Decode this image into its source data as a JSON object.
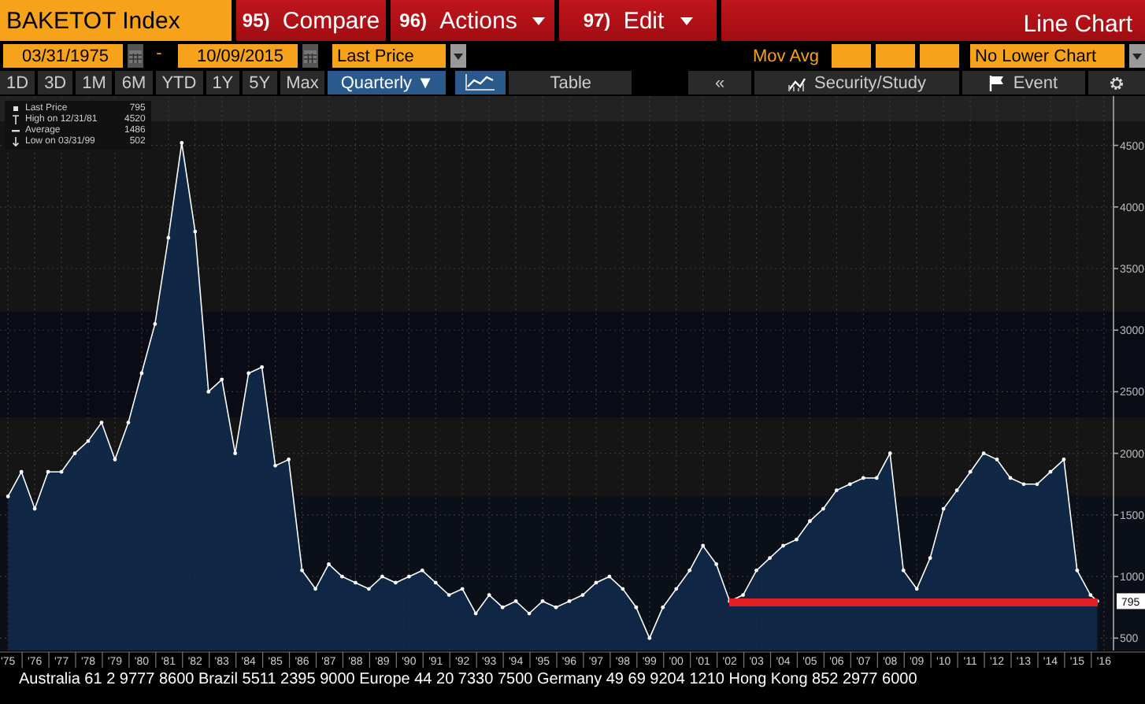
{
  "header": {
    "security": "BAKETOT Index",
    "buttons": [
      {
        "number": "95)",
        "label": "Compare",
        "dropdown": false
      },
      {
        "number": "96)",
        "label": "Actions",
        "dropdown": true
      },
      {
        "number": "97)",
        "label": "Edit",
        "dropdown": true
      }
    ],
    "chart_type": "Line Chart"
  },
  "range": {
    "start_date": "03/31/1975",
    "separator": "-",
    "end_date": "10/09/2015",
    "price_field": "Last Price",
    "mov_avg_label": "Mov Avg",
    "lower_chart": "No Lower Chart"
  },
  "toolbar": {
    "periods": [
      {
        "label": "1D",
        "selected": false
      },
      {
        "label": "3D",
        "selected": false
      },
      {
        "label": "1M",
        "selected": false
      },
      {
        "label": "6M",
        "selected": false
      },
      {
        "label": "YTD",
        "selected": false
      },
      {
        "label": "1Y",
        "selected": false
      },
      {
        "label": "5Y",
        "selected": false
      },
      {
        "label": "Max",
        "selected": false
      }
    ],
    "frequency": "Quarterly ▼",
    "views": [
      {
        "kind": "icon",
        "selected": true
      },
      {
        "kind": "text",
        "label": "Table",
        "selected": false
      }
    ],
    "back": "«",
    "security_study": "Security/Study",
    "event": "Event"
  },
  "chart": {
    "legend": [
      {
        "kind": "last",
        "value": "795"
      },
      {
        "kind": "high",
        "label": "High on 12/31/81",
        "value": "4520"
      },
      {
        "kind": "average",
        "label": "Average",
        "value": "1486"
      },
      {
        "kind": "low",
        "label": "Low on 03/31/99",
        "value": "502"
      }
    ],
    "last_tag": "795",
    "chart_data": {
      "type": "area",
      "xlim": [
        1974.7,
        2016.3
      ],
      "ylim": [
        400,
        4900
      ],
      "x": [
        1975,
        1975.5,
        1976,
        1976.5,
        1977,
        1977.5,
        1978,
        1978.5,
        1979,
        1979.5,
        1980,
        1980.5,
        1981,
        1981.5,
        1982,
        1982.5,
        1983,
        1983.5,
        1984,
        1984.5,
        1985,
        1985.5,
        1986,
        1986.5,
        1987,
        1987.5,
        1988,
        1988.5,
        1989,
        1989.5,
        1990,
        1990.5,
        1991,
        1991.5,
        1992,
        1992.5,
        1993,
        1993.5,
        1994,
        1994.5,
        1995,
        1995.5,
        1996,
        1996.5,
        1997,
        1997.5,
        1998,
        1998.5,
        1999,
        1999.5,
        2000,
        2000.5,
        2001,
        2001.5,
        2002,
        2002.5,
        2003,
        2003.5,
        2004,
        2004.5,
        2005,
        2005.5,
        2006,
        2006.5,
        2007,
        2007.5,
        2008,
        2008.5,
        2009,
        2009.5,
        2010,
        2010.5,
        2011,
        2011.5,
        2012,
        2012.5,
        2013,
        2013.5,
        2014,
        2014.5,
        2015,
        2015.5,
        2015.75
      ],
      "series": [
        {
          "name": "Last Price",
          "color": "#ffffff",
          "values": [
            1650,
            1850,
            1550,
            1850,
            1850,
            2000,
            2100,
            2250,
            1950,
            2250,
            2650,
            3050,
            3750,
            4520,
            3800,
            2500,
            2600,
            2000,
            2650,
            2700,
            1900,
            1950,
            1050,
            900,
            1100,
            1000,
            950,
            900,
            1000,
            950,
            1000,
            1050,
            950,
            850,
            900,
            700,
            850,
            750,
            800,
            700,
            800,
            750,
            800,
            850,
            950,
            1000,
            900,
            750,
            500,
            750,
            900,
            1050,
            1250,
            1100,
            800,
            850,
            1050,
            1150,
            1250,
            1300,
            1450,
            1550,
            1700,
            1750,
            1800,
            1800,
            2000,
            1050,
            900,
            1150,
            1550,
            1700,
            1850,
            2000,
            1950,
            1800,
            1750,
            1750,
            1850,
            1950,
            1050,
            850,
            800
          ]
        }
      ],
      "grid": true,
      "xticks": [
        {
          "value": 1975,
          "label": "'75"
        },
        {
          "value": 1976,
          "label": "'76"
        },
        {
          "value": 1977,
          "label": "'77"
        },
        {
          "value": 1978,
          "label": "'78"
        },
        {
          "value": 1979,
          "label": "'79"
        },
        {
          "value": 1980,
          "label": "'80"
        },
        {
          "value": 1981,
          "label": "'81"
        },
        {
          "value": 1982,
          "label": "'82"
        },
        {
          "value": 1983,
          "label": "'83"
        },
        {
          "value": 1984,
          "label": "'84"
        },
        {
          "value": 1985,
          "label": "'85"
        },
        {
          "value": 1986,
          "label": "'86"
        },
        {
          "value": 1987,
          "label": "'87"
        },
        {
          "value": 1988,
          "label": "'88"
        },
        {
          "value": 1989,
          "label": "'89"
        },
        {
          "value": 1990,
          "label": "'90"
        },
        {
          "value": 1991,
          "label": "'91"
        },
        {
          "value": 1992,
          "label": "'92"
        },
        {
          "value": 1993,
          "label": "'93"
        },
        {
          "value": 1994,
          "label": "'94"
        },
        {
          "value": 1995,
          "label": "'95"
        },
        {
          "value": 1996,
          "label": "'96"
        },
        {
          "value": 1997,
          "label": "'97"
        },
        {
          "value": 1998,
          "label": "'98"
        },
        {
          "value": 1999,
          "label": "'99"
        },
        {
          "value": 2000,
          "label": "'00"
        },
        {
          "value": 2001,
          "label": "'01"
        },
        {
          "value": 2002,
          "label": "'02"
        },
        {
          "value": 2003,
          "label": "'03"
        },
        {
          "value": 2004,
          "label": "'04"
        },
        {
          "value": 2005,
          "label": "'05"
        },
        {
          "value": 2006,
          "label": "'06"
        },
        {
          "value": 2007,
          "label": "'07"
        },
        {
          "value": 2008,
          "label": "'08"
        },
        {
          "value": 2009,
          "label": "'09"
        },
        {
          "value": 2010,
          "label": "'10"
        },
        {
          "value": 2011,
          "label": "'11"
        },
        {
          "value": 2012,
          "label": "'12"
        },
        {
          "value": 2013,
          "label": "'13"
        },
        {
          "value": 2014,
          "label": "'14"
        },
        {
          "value": 2015,
          "label": "'15"
        },
        {
          "value": 2016,
          "label": "'16"
        }
      ],
      "yticks": [
        500,
        1000,
        1500,
        2000,
        2500,
        3000,
        3500,
        4000,
        4500
      ]
    }
  },
  "footer": "Australia 61 2 9777 8600 Brazil 5511 2395 9000 Europe 44 20 7330 7500 Germany 49 69 9204 1210 Hong Kong 852 2977 6000"
}
